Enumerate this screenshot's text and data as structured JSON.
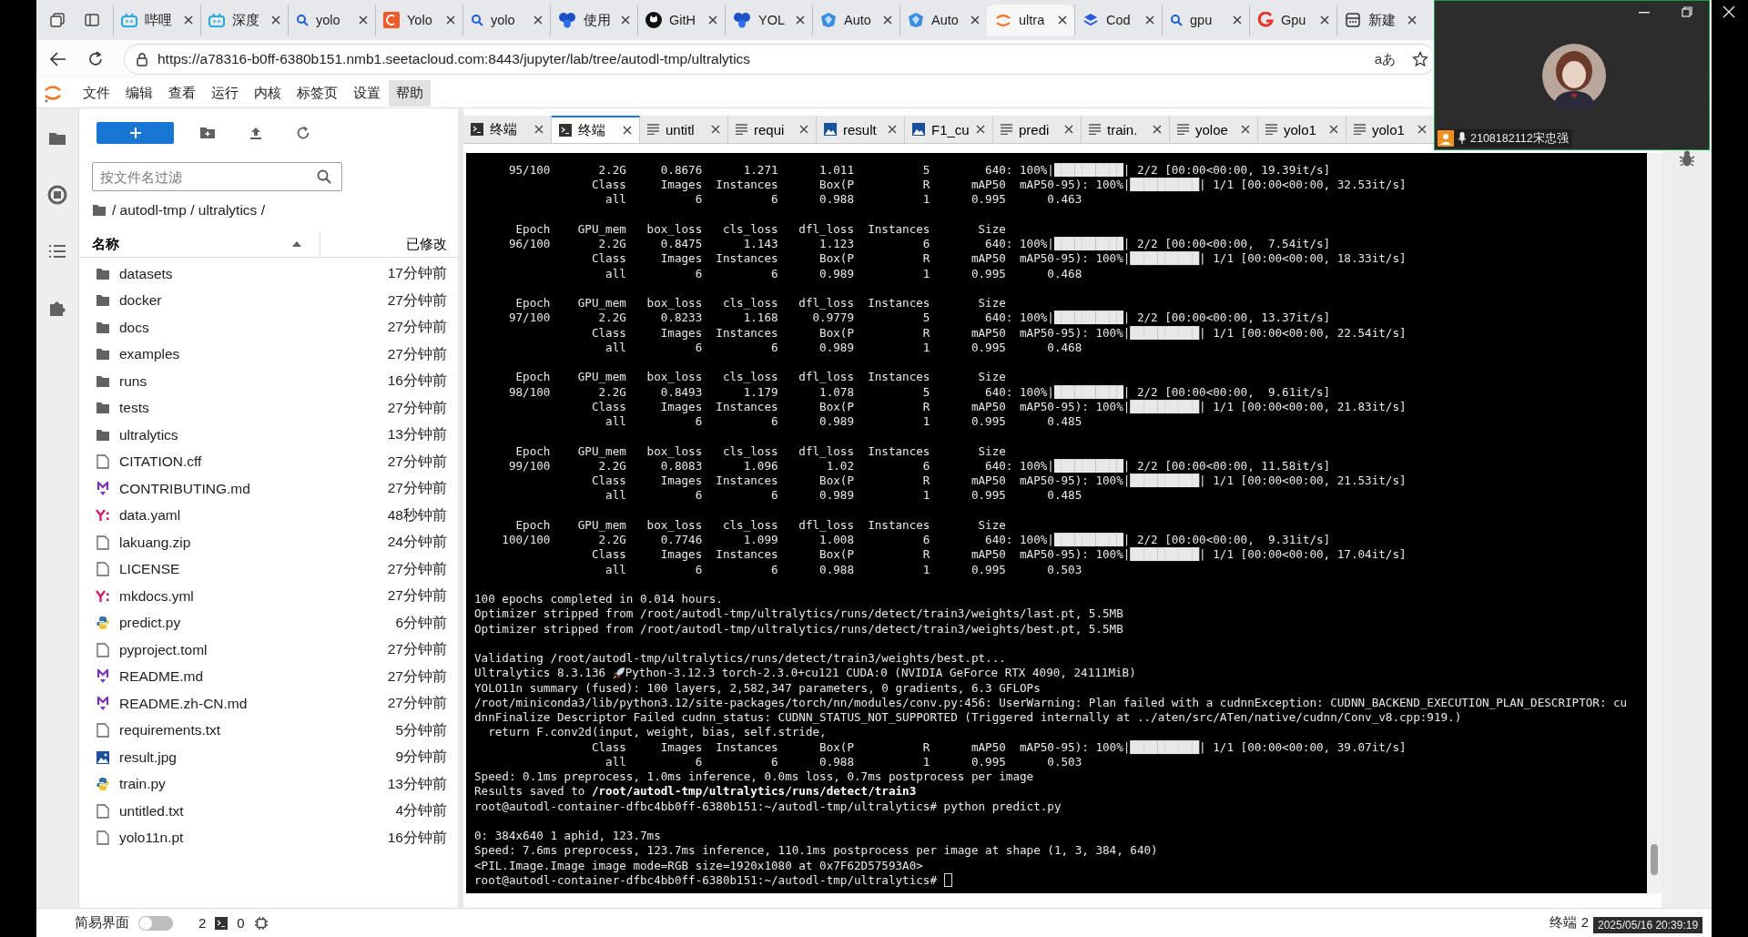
{
  "browser": {
    "tabs": [
      {
        "label": "哔哩",
        "selected": false
      },
      {
        "label": "深度",
        "selected": false
      },
      {
        "label": "yolo",
        "selected": false
      },
      {
        "label": "Yolo",
        "selected": false
      },
      {
        "label": "yolo",
        "selected": false
      },
      {
        "label": "使用",
        "selected": false
      },
      {
        "label": "GitH",
        "selected": false
      },
      {
        "label": "YOL",
        "selected": false
      },
      {
        "label": "Auto",
        "selected": false
      },
      {
        "label": "Auto",
        "selected": false
      },
      {
        "label": "ultra",
        "selected": true
      },
      {
        "label": "Cod",
        "selected": false
      },
      {
        "label": "gpu",
        "selected": false
      },
      {
        "label": "Gpu",
        "selected": false
      },
      {
        "label": "新建",
        "selected": false
      }
    ],
    "url": "https://a78316-b0ff-6380b151.nmb1.seetacloud.com:8443/jupyter/lab/tree/autodl-tmp/ultralytics",
    "read_aloud": "aあ"
  },
  "menu": [
    {
      "label": "文件",
      "selected": false
    },
    {
      "label": "编辑",
      "selected": false
    },
    {
      "label": "查看",
      "selected": false
    },
    {
      "label": "运行",
      "selected": false
    },
    {
      "label": "内核",
      "selected": false
    },
    {
      "label": "标签页",
      "selected": false
    },
    {
      "label": "设置",
      "selected": false
    },
    {
      "label": "帮助",
      "selected": true
    }
  ],
  "file_browser": {
    "filter": {
      "placeholder": "按文件名过滤"
    },
    "breadcrumb": "/ autodl-tmp / ultralytics /",
    "columns": [
      "名称",
      "已修改"
    ],
    "files": [
      {
        "kind": "folder",
        "name": "datasets",
        "modified": "17分钟前"
      },
      {
        "kind": "folder",
        "name": "docker",
        "modified": "27分钟前"
      },
      {
        "kind": "folder",
        "name": "docs",
        "modified": "27分钟前"
      },
      {
        "kind": "folder",
        "name": "examples",
        "modified": "27分钟前"
      },
      {
        "kind": "folder",
        "name": "runs",
        "modified": "16分钟前"
      },
      {
        "kind": "folder",
        "name": "tests",
        "modified": "27分钟前"
      },
      {
        "kind": "folder",
        "name": "ultralytics",
        "modified": "13分钟前"
      },
      {
        "kind": "file",
        "name": "CITATION.cff",
        "modified": "27分钟前"
      },
      {
        "kind": "markdown",
        "name": "CONTRIBUTING.md",
        "modified": "27分钟前"
      },
      {
        "kind": "yaml",
        "name": "data.yaml",
        "modified": "48秒钟前"
      },
      {
        "kind": "file",
        "name": "lakuang.zip",
        "modified": "24分钟前"
      },
      {
        "kind": "file",
        "name": "LICENSE",
        "modified": "27分钟前"
      },
      {
        "kind": "yaml",
        "name": "mkdocs.yml",
        "modified": "27分钟前"
      },
      {
        "kind": "python",
        "name": "predict.py",
        "modified": "6分钟前"
      },
      {
        "kind": "file",
        "name": "pyproject.toml",
        "modified": "27分钟前"
      },
      {
        "kind": "markdown",
        "name": "README.md",
        "modified": "27分钟前"
      },
      {
        "kind": "markdown",
        "name": "README.zh-CN.md",
        "modified": "27分钟前"
      },
      {
        "kind": "file",
        "name": "requirements.txt",
        "modified": "5分钟前"
      },
      {
        "kind": "image",
        "name": "result.jpg",
        "modified": "9分钟前"
      },
      {
        "kind": "python",
        "name": "train.py",
        "modified": "13分钟前"
      },
      {
        "kind": "file",
        "name": "untitled.txt",
        "modified": "4分钟前"
      },
      {
        "kind": "file",
        "name": "yolo11n.pt",
        "modified": "16分钟前"
      }
    ]
  },
  "dock_tabs": [
    {
      "kind": "terminal",
      "label": "终端",
      "selected": false
    },
    {
      "kind": "terminal",
      "label": "终端",
      "selected": true
    },
    {
      "kind": "text",
      "label": "untitl",
      "selected": false
    },
    {
      "kind": "text",
      "label": "requi",
      "selected": false
    },
    {
      "kind": "image",
      "label": "result",
      "selected": false
    },
    {
      "kind": "image",
      "label": "F1_cu",
      "selected": false
    },
    {
      "kind": "text",
      "label": "predi",
      "selected": false
    },
    {
      "kind": "text",
      "label": "train.",
      "selected": false
    },
    {
      "kind": "text",
      "label": "yoloe",
      "selected": false
    },
    {
      "kind": "text",
      "label": "yolo1",
      "selected": false
    },
    {
      "kind": "text",
      "label": "yolo1",
      "selected": false
    }
  ],
  "terminal": {
    "blocks": [
      [
        "     95/100       2.2G     0.8676      1.271      1.011          5        640: 100%|██████████| 2/2 [00:00<00:00, 19.39it/s]",
        "                 Class     Images  Instances      Box(P          R      mAP50  mAP50-95): 100%|██████████| 1/1 [00:00<00:00, 32.53it/s]",
        "                   all          6          6      0.988          1      0.995      0.463"
      ],
      [
        "      Epoch    GPU_mem   box_loss   cls_loss   dfl_loss  Instances       Size",
        "     96/100       2.2G     0.8475      1.143      1.123          6        640: 100%|██████████| 2/2 [00:00<00:00,  7.54it/s]",
        "                 Class     Images  Instances      Box(P          R      mAP50  mAP50-95): 100%|██████████| 1/1 [00:00<00:00, 18.33it/s]",
        "                   all          6          6      0.989          1      0.995      0.468"
      ],
      [
        "      Epoch    GPU_mem   box_loss   cls_loss   dfl_loss  Instances       Size",
        "     97/100       2.2G     0.8233      1.168     0.9779          5        640: 100%|██████████| 2/2 [00:00<00:00, 13.37it/s]",
        "                 Class     Images  Instances      Box(P          R      mAP50  mAP50-95): 100%|██████████| 1/1 [00:00<00:00, 22.54it/s]",
        "                   all          6          6      0.989          1      0.995      0.468"
      ],
      [
        "      Epoch    GPU_mem   box_loss   cls_loss   dfl_loss  Instances       Size",
        "     98/100       2.2G     0.8493      1.179      1.078          5        640: 100%|██████████| 2/2 [00:00<00:00,  9.61it/s]",
        "                 Class     Images  Instances      Box(P          R      mAP50  mAP50-95): 100%|██████████| 1/1 [00:00<00:00, 21.83it/s]",
        "                   all          6          6      0.989          1      0.995      0.485"
      ],
      [
        "      Epoch    GPU_mem   box_loss   cls_loss   dfl_loss  Instances       Size",
        "     99/100       2.2G     0.8083      1.096       1.02          6        640: 100%|██████████| 2/2 [00:00<00:00, 11.58it/s]",
        "                 Class     Images  Instances      Box(P          R      mAP50  mAP50-95): 100%|██████████| 1/1 [00:00<00:00, 21.53it/s]",
        "                   all          6          6      0.989          1      0.995      0.485"
      ],
      [
        "      Epoch    GPU_mem   box_loss   cls_loss   dfl_loss  Instances       Size",
        "    100/100       2.2G     0.7746      1.099      1.008          6        640: 100%|██████████| 2/2 [00:00<00:00,  9.31it/s]",
        "                 Class     Images  Instances      Box(P          R      mAP50  mAP50-95): 100%|██████████| 1/1 [00:00<00:00, 17.04it/s]",
        "                   all          6          6      0.988          1      0.995      0.503"
      ],
      [
        "100 epochs completed in 0.014 hours.",
        "Optimizer stripped from /root/autodl-tmp/ultralytics/runs/detect/train3/weights/last.pt, 5.5MB",
        "Optimizer stripped from /root/autodl-tmp/ultralytics/runs/detect/train3/weights/best.pt, 5.5MB"
      ],
      [
        "Validating /root/autodl-tmp/ultralytics/runs/detect/train3/weights/best.pt...",
        {
          "kind": "rocket",
          "before": "Ultralytics 8.3.136 ",
          "after": "Python-3.12.3 torch-2.3.0+cu121 CUDA:0 (NVIDIA GeForce RTX 4090, 24111MiB)"
        },
        "YOLO11n summary (fused): 100 layers, 2,582,347 parameters, 0 gradients, 6.3 GFLOPs",
        "/root/miniconda3/lib/python3.12/site-packages/torch/nn/modules/conv.py:456: UserWarning: Plan failed with a cudnnException: CUDNN_BACKEND_EXECUTION_PLAN_DESCRIPTOR: cu",
        "dnnFinalize Descriptor Failed cudnn_status: CUDNN_STATUS_NOT_SUPPORTED (Triggered internally at ../aten/src/ATen/native/cudnn/Conv_v8.cpp:919.)",
        "  return F.conv2d(input, weight, bias, self.stride,",
        "                 Class     Images  Instances      Box(P          R      mAP50  mAP50-95): 100%|██████████| 1/1 [00:00<00:00, 39.07it/s]",
        "                   all          6          6      0.988          1      0.995      0.503",
        "Speed: 0.1ms preprocess, 1.0ms inference, 0.0ms loss, 0.7ms postprocess per image",
        "Results saved to **/root/autodl-tmp/ultralytics/runs/detect/train3**",
        "root@autodl-container-dfbc4bb0ff-6380b151:~/autodl-tmp/ultralytics# python predict.py"
      ],
      [
        "0: 384x640 1 aphid, 123.7ms",
        "Speed: 7.6ms preprocess, 123.7ms inference, 110.1ms postprocess per image at shape (1, 3, 384, 640)",
        "<PIL.Image.Image image mode=RGB size=1920x1080 at 0x7F62D57593A0>",
        {
          "kind": "prompt",
          "text": "root@autodl-container-dfbc4bb0ff-6380b151:~/autodl-tmp/ultralytics#"
        }
      ]
    ]
  },
  "status_bar": {
    "simple_mode": {
      "label": "简易界面",
      "on": false
    },
    "terminals": "2",
    "kernels": "0",
    "right": "终端 2"
  },
  "video_call": {
    "participant": "2108182112宋忠强"
  },
  "timestamp": "2025/05/16 20:39:19"
}
